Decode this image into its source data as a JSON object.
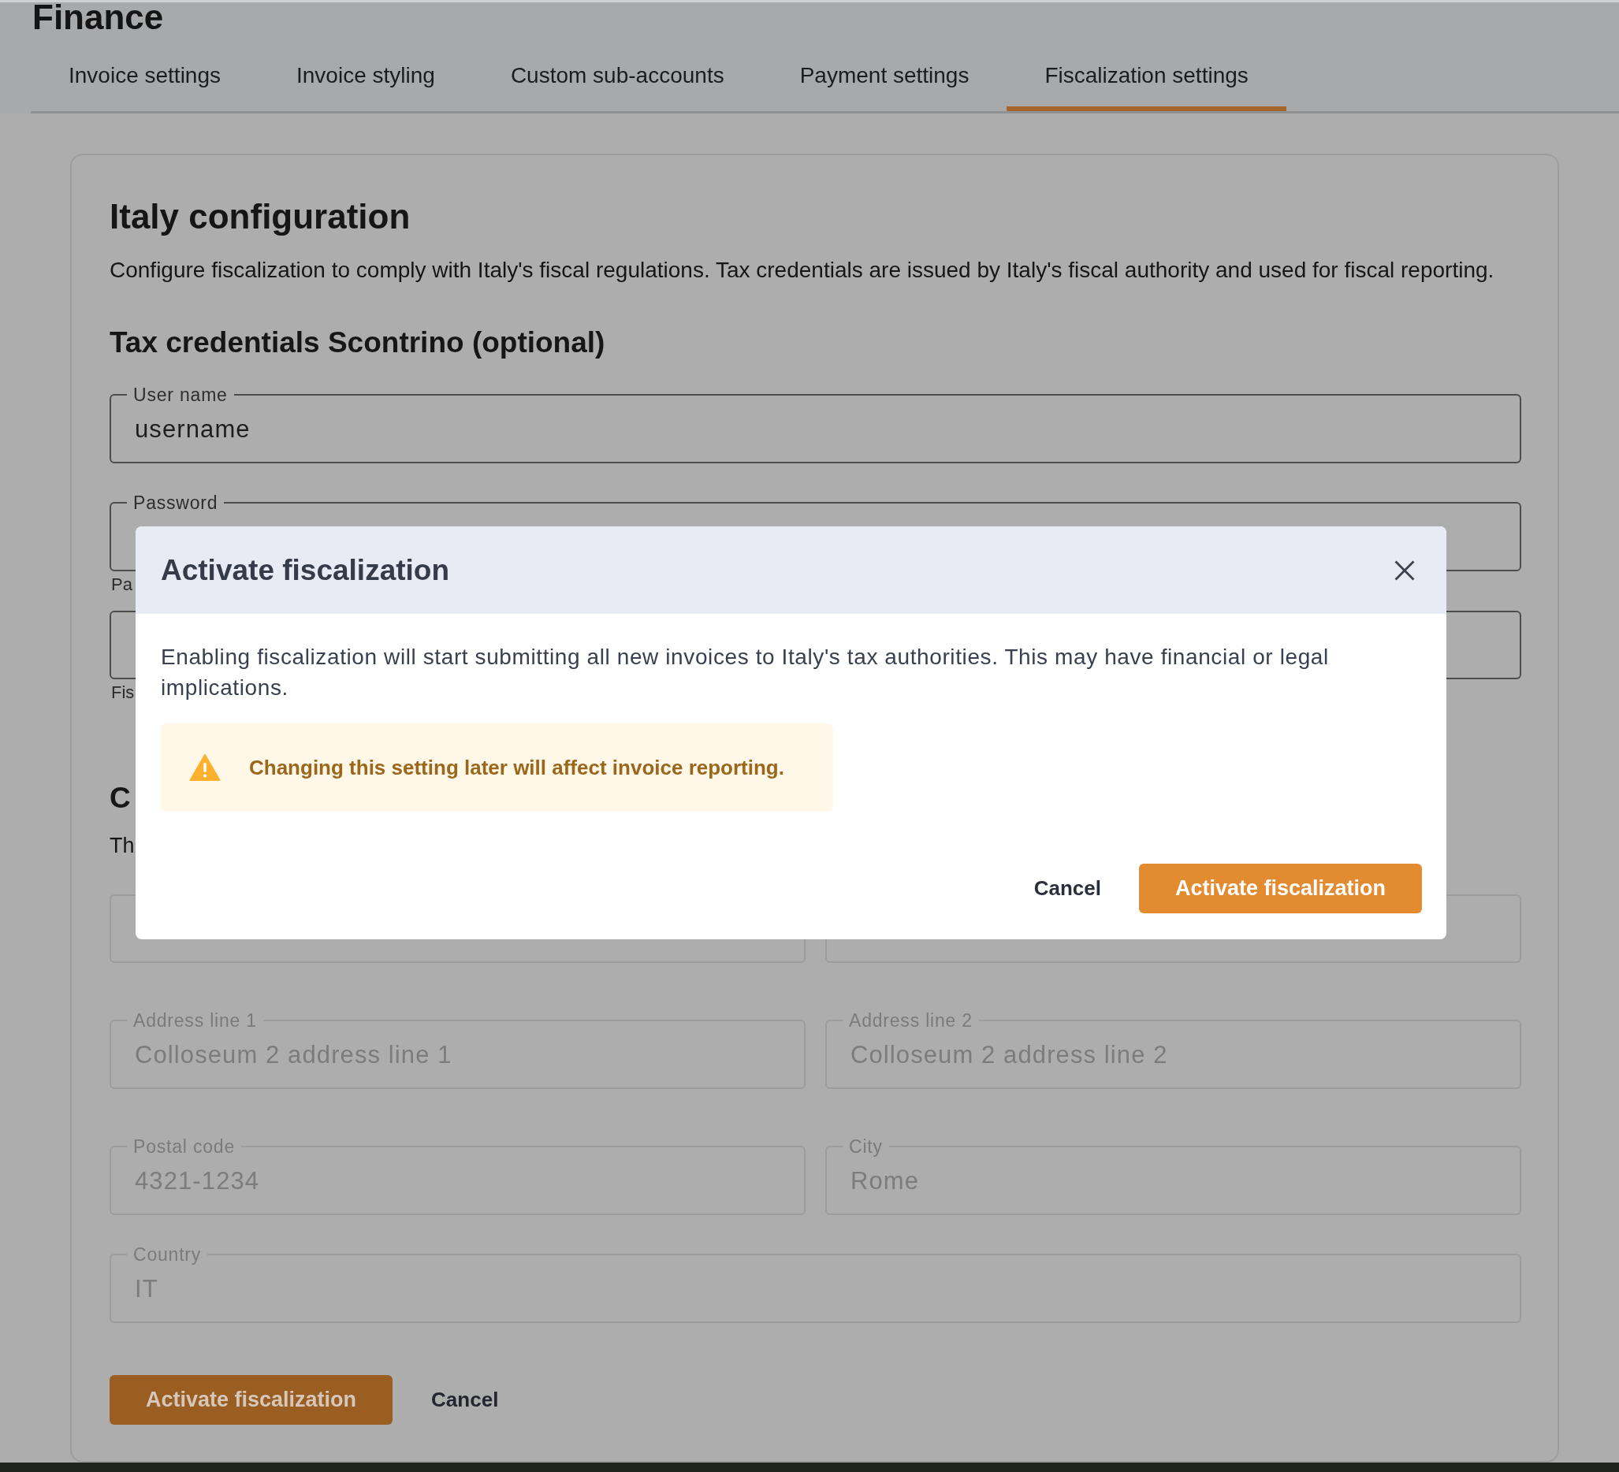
{
  "page": {
    "title": "Finance"
  },
  "tabs": [
    {
      "label": "Invoice settings",
      "selected": false
    },
    {
      "label": "Invoice styling",
      "selected": false
    },
    {
      "label": "Custom sub-accounts",
      "selected": false
    },
    {
      "label": "Payment settings",
      "selected": false
    },
    {
      "label": "Fiscalization settings",
      "selected": true
    }
  ],
  "panel": {
    "title": "Italy configuration",
    "description": "Configure fiscalization to comply with Italy's fiscal regulations. Tax credentials are issued by Italy's fiscal authority and used for fiscal reporting.",
    "sections": [
      {
        "heading": "Tax credentials Scontrino (optional)",
        "rows": [
          [
            {
              "label": "User name",
              "value": "username",
              "disabled": false
            }
          ],
          [
            {
              "label": "Password",
              "helper": "Pa",
              "disabled": false
            }
          ],
          [
            {
              "helper": "Fis",
              "disabled": false
            }
          ]
        ]
      },
      {
        "heading": "C",
        "description": "Th",
        "rows": [
          [
            {
              "disabled": true
            },
            {
              "disabled": true
            }
          ],
          [
            {
              "label": "Address line 1",
              "value": "Colloseum 2 address line 1",
              "disabled": true
            },
            {
              "label": "Address line 2",
              "value": "Colloseum 2 address line 2",
              "disabled": true
            }
          ],
          [
            {
              "label": "Postal code",
              "value": "4321-1234",
              "disabled": true
            },
            {
              "label": "City",
              "value": "Rome",
              "disabled": true
            }
          ],
          [
            {
              "label": "Country",
              "value": "IT",
              "disabled": true
            }
          ]
        ]
      }
    ],
    "actions": [
      {
        "kind": "primary",
        "label": "Activate fiscalization"
      },
      {
        "kind": "text",
        "label": "Cancel"
      }
    ]
  },
  "dialog": {
    "title": "Activate fiscalization",
    "body": "Enabling fiscalization will start submitting all new invoices to Italy's tax authorities. This may have financial or legal implications.",
    "alert": {
      "kind": "warning",
      "text": "Changing this setting later will affect invoice reporting."
    },
    "actions": [
      {
        "kind": "text",
        "label": "Cancel"
      },
      {
        "kind": "primary",
        "label": "Activate fiscalization"
      }
    ]
  }
}
